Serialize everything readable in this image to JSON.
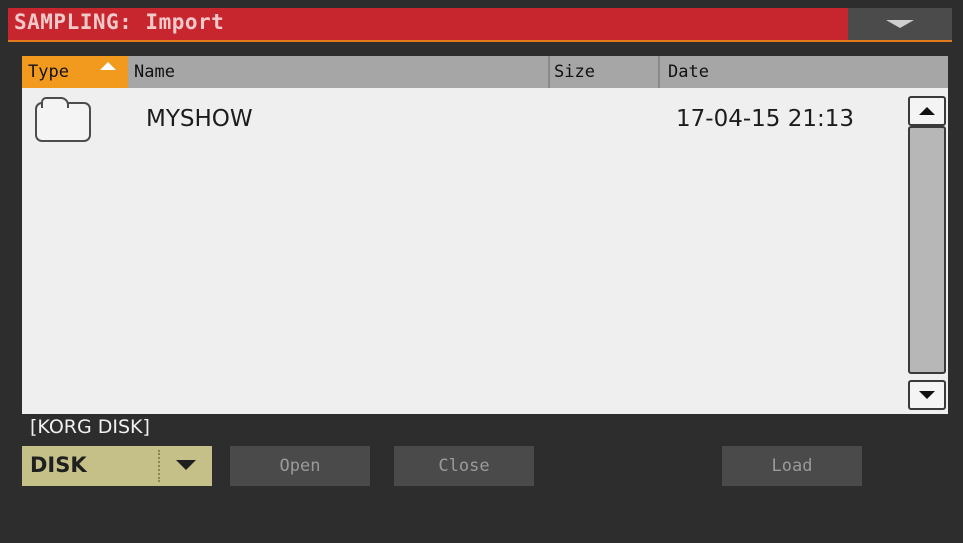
{
  "window": {
    "title": "SAMPLING: Import"
  },
  "list": {
    "columns": {
      "type": "Type",
      "name": "Name",
      "size": "Size",
      "date": "Date"
    },
    "rows": [
      {
        "type_icon": "folder-icon",
        "name": "MYSHOW",
        "size": "",
        "date": "17-04-15 21:13"
      }
    ]
  },
  "location": {
    "path": "[KORG DISK]",
    "device": "DISK"
  },
  "buttons": {
    "open": "Open",
    "close": "Close",
    "load": "Load"
  },
  "colors": {
    "title_bar": "#c8262e",
    "sort_column": "#f29a1e",
    "device_selector": "#c4c088",
    "background": "#2d2d2d"
  }
}
